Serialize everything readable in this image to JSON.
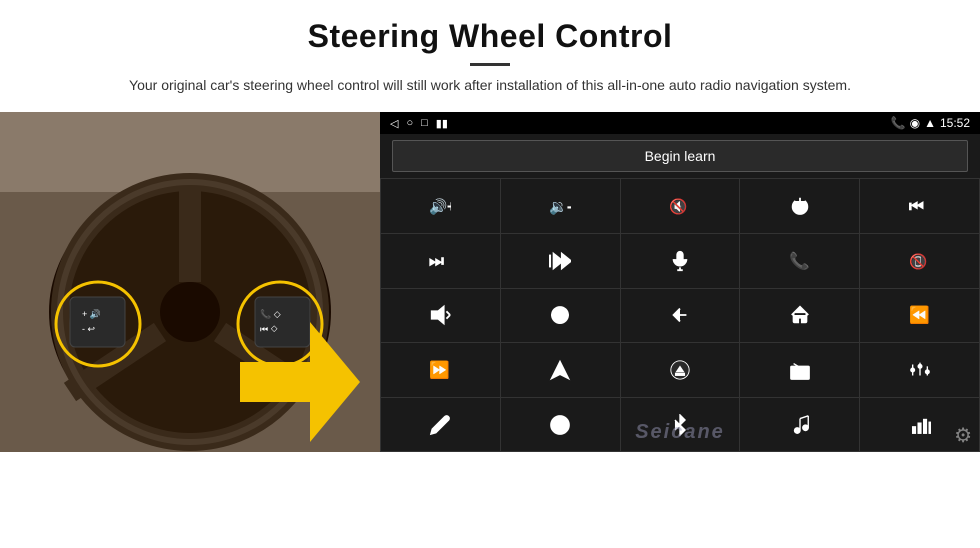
{
  "header": {
    "title": "Steering Wheel Control",
    "subtitle": "Your original car's steering wheel control will still work after installation of this all-in-one auto radio navigation system."
  },
  "status_bar": {
    "left_icons": [
      "back-icon",
      "home-icon",
      "recent-icon",
      "media-icon"
    ],
    "phone_icon": "📞",
    "location_icon": "📍",
    "wifi_icon": "📶",
    "time": "15:52"
  },
  "begin_learn": {
    "button_label": "Begin learn"
  },
  "grid": {
    "cells": [
      {
        "icon": "vol-up",
        "symbol": "🔊+"
      },
      {
        "icon": "vol-down",
        "symbol": "🔊-"
      },
      {
        "icon": "mute",
        "symbol": "🔇"
      },
      {
        "icon": "power",
        "symbol": "⏻"
      },
      {
        "icon": "prev-track",
        "symbol": "⏮"
      },
      {
        "icon": "next-track",
        "symbol": "⏭"
      },
      {
        "icon": "fast-forward-mute",
        "symbol": "⏭"
      },
      {
        "icon": "mic",
        "symbol": "🎤"
      },
      {
        "icon": "phone",
        "symbol": "📞"
      },
      {
        "icon": "hang-up",
        "symbol": "📵"
      },
      {
        "icon": "horn",
        "symbol": "📢"
      },
      {
        "icon": "360-view",
        "symbol": "🔄"
      },
      {
        "icon": "back",
        "symbol": "↩"
      },
      {
        "icon": "home",
        "symbol": "🏠"
      },
      {
        "icon": "rewind",
        "symbol": "⏪"
      },
      {
        "icon": "fast-forward",
        "symbol": "⏩"
      },
      {
        "icon": "navigate",
        "symbol": "➤"
      },
      {
        "icon": "eject",
        "symbol": "⏏"
      },
      {
        "icon": "radio",
        "symbol": "📻"
      },
      {
        "icon": "equalizer",
        "symbol": "🎚"
      },
      {
        "icon": "pen",
        "symbol": "✏"
      },
      {
        "icon": "settings-circle",
        "symbol": "⚙"
      },
      {
        "icon": "bluetooth",
        "symbol": "⚡"
      },
      {
        "icon": "music",
        "symbol": "🎵"
      },
      {
        "icon": "bars",
        "symbol": "📊"
      }
    ]
  },
  "watermark": "Seicane",
  "gear_icon": "⚙"
}
